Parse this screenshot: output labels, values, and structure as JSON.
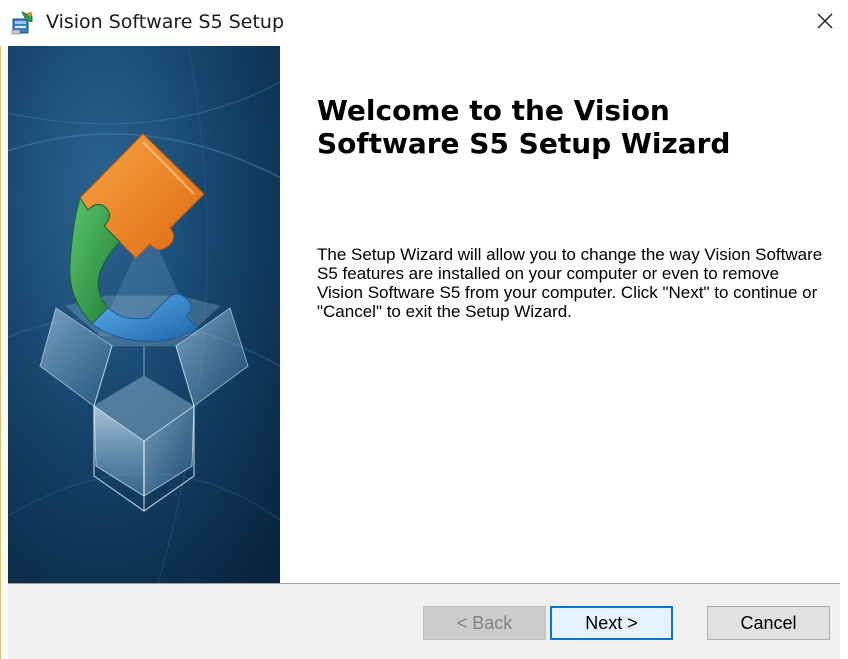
{
  "window": {
    "title": "Vision Software S5 Setup",
    "icon": "setup-installer-icon",
    "close_icon": "close-icon"
  },
  "banner": {
    "image": "software-box-with-puzzle-logo",
    "colors": {
      "background": "#0f3555",
      "orange": "#ef7d1a",
      "green": "#2e9a48",
      "blue": "#2f86d0"
    }
  },
  "content": {
    "heading": "Welcome to the Vision Software S5 Setup Wizard",
    "body": "The Setup Wizard will allow you to change the way Vision Software S5 features are installed on your computer or even to remove Vision Software S5 from your computer.  Click \"Next\" to continue or \"Cancel\" to exit the Setup Wizard."
  },
  "footer": {
    "back_label": "< Back",
    "next_label": "Next >",
    "cancel_label": "Cancel",
    "back_enabled": false
  }
}
